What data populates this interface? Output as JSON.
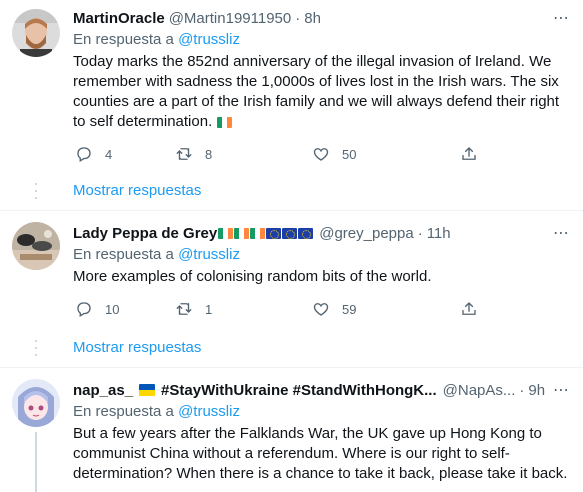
{
  "tweets": [
    {
      "name": "MartinOracle",
      "handle": "@Martin19911950",
      "time": "8h",
      "reply_prefix": "En respuesta a ",
      "reply_mention": "@trussliz",
      "text": "Today marks the 852nd anniversary of the illegal invasion of Ireland. We remember with sadness the 1,0000s of lives lost in the Irish wars.  The six counties are a part of the Irish family and we will always defend their right to self determination.",
      "replies": "4",
      "retweets": "8",
      "likes": "50",
      "show_replies": "Mostrar respuestas"
    },
    {
      "name": "Lady Peppa de Grey",
      "handle": "@grey_peppa",
      "time": "11h",
      "reply_prefix": "En respuesta a ",
      "reply_mention": "@trussliz",
      "text": "More examples of colonising random bits of the world.",
      "replies": "10",
      "retweets": "1",
      "likes": "59",
      "show_replies": "Mostrar respuestas"
    },
    {
      "name_prefix": "nap_as_",
      "name_suffix": "#StayWithUkraine #StandWithHongK...",
      "handle": "@NapAs...",
      "time": "9h",
      "reply_prefix": "En respuesta a ",
      "reply_mention": "@trussliz",
      "text": "But a few years after the Falklands War, the UK gave up Hong Kong to communist China without a referendum. Where is our right to self-determination? When there is a chance to take it back, please take it back."
    }
  ],
  "separator": "·",
  "colors": {
    "accent": "#1d9bf0",
    "secondary_text": "#536471",
    "divider": "#eff3f4"
  }
}
